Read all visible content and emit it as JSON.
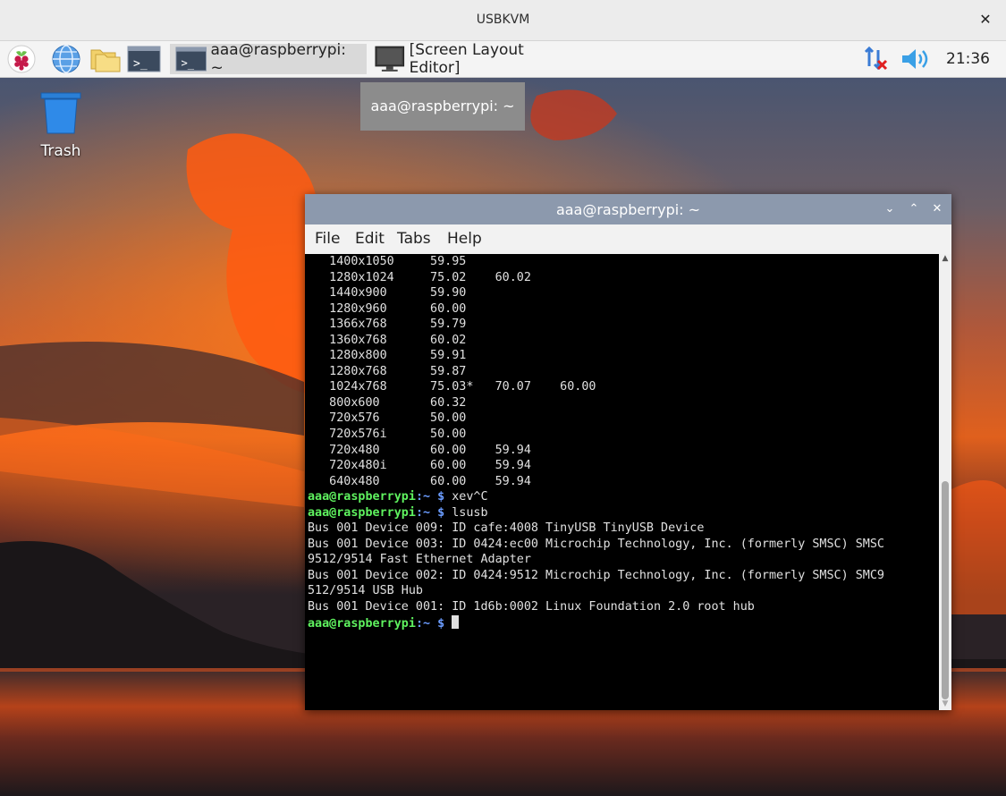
{
  "outer_window": {
    "title": "USBKVM",
    "close": "✕"
  },
  "panel": {
    "tasks": [
      {
        "label": "aaa@raspberrypi: ~"
      },
      {
        "label": "[Screen Layout Editor]"
      }
    ],
    "clock": "21:36"
  },
  "desktop": {
    "trash_label": "Trash",
    "tooltip": "aaa@raspberrypi: ~"
  },
  "terminal": {
    "title": "aaa@raspberrypi: ~",
    "controls": {
      "minimize": "⌄",
      "maximize": "⌃",
      "close": "✕"
    },
    "menu": [
      "File",
      "Edit",
      "Tabs",
      "Help"
    ],
    "lines": [
      "   1400x1050     59.95",
      "   1280x1024     75.02    60.02",
      "   1440x900      59.90",
      "   1280x960      60.00",
      "   1366x768      59.79",
      "   1360x768      60.02",
      "   1280x800      59.91",
      "   1280x768      59.87",
      "   1024x768      75.03*   70.07    60.00",
      "   800x600       60.32",
      "   720x576       50.00",
      "   720x576i      50.00",
      "   720x480       60.00    59.94",
      "   720x480i      60.00    59.94",
      "   640x480       60.00    59.94"
    ],
    "prompt_user": "aaa@raspberrypi",
    "prompt_path": ":~ $ ",
    "cmd1": "xev^C",
    "cmd2": "lsusb",
    "output": [
      "Bus 001 Device 009: ID cafe:4008 TinyUSB TinyUSB Device",
      "Bus 001 Device 003: ID 0424:ec00 Microchip Technology, Inc. (formerly SMSC) SMSC",
      "9512/9514 Fast Ethernet Adapter",
      "Bus 001 Device 002: ID 0424:9512 Microchip Technology, Inc. (formerly SMSC) SMC9",
      "512/9514 USB Hub",
      "Bus 001 Device 001: ID 1d6b:0002 Linux Foundation 2.0 root hub"
    ]
  }
}
